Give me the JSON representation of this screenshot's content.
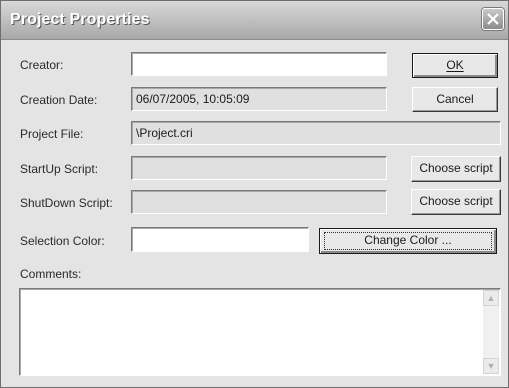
{
  "window": {
    "title": "Project Properties"
  },
  "fields": {
    "creator_label": "Creator:",
    "creator_value": "",
    "creation_date_label": "Creation Date:",
    "creation_date_value": "06/07/2005, 10:05:09",
    "project_file_label": "Project File:",
    "project_file_value": "\\Project.cri",
    "startup_label": "StartUp Script:",
    "startup_value": "",
    "shutdown_label": "ShutDown Script:",
    "shutdown_value": "",
    "selection_color_label": "Selection Color:",
    "selection_color_value": "",
    "comments_label": "Comments:",
    "comments_value": ""
  },
  "buttons": {
    "ok_label": "OK",
    "cancel_label": "Cancel",
    "choose_script_startup_label": "Choose script",
    "choose_script_shutdown_label": "Choose script",
    "change_color_label": "Change Color ..."
  },
  "icons": {
    "close": "close-icon",
    "scroll_up": "scroll-up-icon",
    "scroll_down": "scroll-down-icon"
  },
  "colors": {
    "dialog_background": "#e4e4e4",
    "title_text": "#ffffff",
    "field_white": "#ffffff",
    "field_gray": "#e0e0e0"
  }
}
